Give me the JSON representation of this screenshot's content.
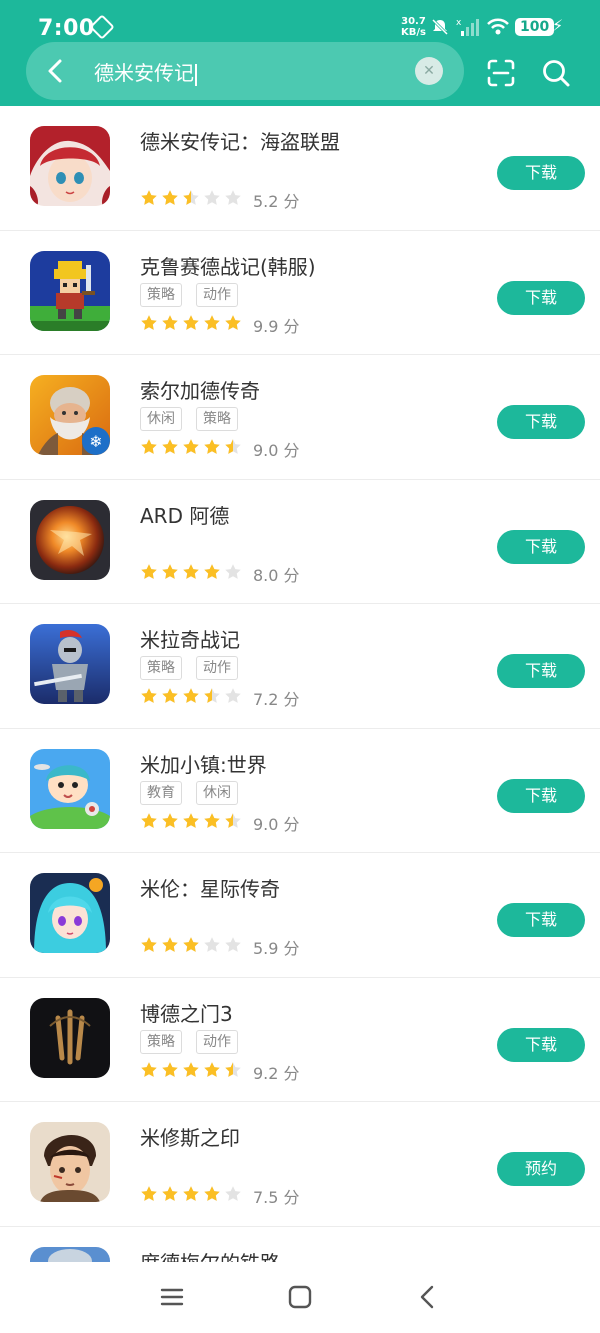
{
  "status_bar": {
    "time": "7:00",
    "net_speed_value": "30.7",
    "net_speed_unit": "KB/s",
    "battery": "100"
  },
  "search": {
    "query": "德米安传记"
  },
  "results": [
    {
      "name": "德米安传记：海盗联盟",
      "tags": [],
      "rating": 2.5,
      "score": "5.2 分",
      "button": "下载",
      "icon": "anime-girl-red-hair-icon"
    },
    {
      "name": "克鲁赛德战记(韩服)",
      "tags": [
        "策略",
        "动作"
      ],
      "rating": 5,
      "score": "9.9 分",
      "button": "下载",
      "icon": "pixel-knight-icon"
    },
    {
      "name": "索尔加德传奇",
      "tags": [
        "休闲",
        "策略"
      ],
      "rating": 4.5,
      "score": "9.0 分",
      "button": "下载",
      "icon": "old-viking-icon"
    },
    {
      "name": "ARD 阿德",
      "tags": [],
      "rating": 4,
      "score": "8.0 分",
      "button": "下载",
      "icon": "fire-planet-icon"
    },
    {
      "name": "米拉奇战记",
      "tags": [
        "策略",
        "动作"
      ],
      "rating": 3.5,
      "score": "7.2 分",
      "button": "下载",
      "icon": "armored-knight-icon"
    },
    {
      "name": "米加小镇:世界",
      "tags": [
        "教育",
        "休闲"
      ],
      "rating": 4.5,
      "score": "9.0 分",
      "button": "下载",
      "icon": "cartoon-kid-icon"
    },
    {
      "name": "米伦：星际传奇",
      "tags": [],
      "rating": 3,
      "score": "5.9 分",
      "button": "下载",
      "icon": "blue-hair-girl-icon"
    },
    {
      "name": "博德之门3",
      "tags": [
        "策略",
        "动作"
      ],
      "rating": 4.5,
      "score": "9.2 分",
      "button": "下载",
      "icon": "baldurs-gate-logo-icon"
    },
    {
      "name": "米修斯之印",
      "tags": [],
      "rating": 4,
      "score": "7.5 分",
      "button": "预约",
      "icon": "warrior-man-icon"
    },
    {
      "name": "席德梅尔的铁路",
      "tags": [],
      "rating": 0,
      "score": "",
      "button": "",
      "icon": "railroad-icon"
    }
  ],
  "colors": {
    "accent": "#1db89b",
    "star_on": "#fbbf24",
    "star_off": "#e3e3e3"
  }
}
